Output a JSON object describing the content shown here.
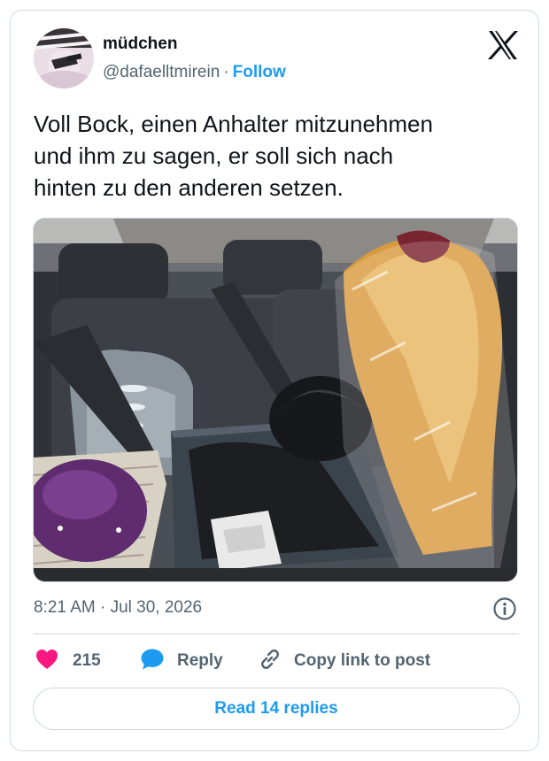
{
  "author": {
    "display_name": "müdchen",
    "handle": "@dafaelltmirein",
    "separator": "·",
    "follow_label": "Follow"
  },
  "tweet": {
    "text": "Voll Bock, einen Anhalter mitzunehmen\nund ihm zu sagen, er soll sich nach\nhinten zu den anderen setzen.",
    "timestamp": "8:21 AM · Jul 30, 2026"
  },
  "actions": {
    "like_count": "215",
    "reply_label": "Reply",
    "copy_label": "Copy link to post"
  },
  "read_replies_label": "Read 14 replies",
  "icons": {
    "brand": "x-logo-icon",
    "like": "heart-icon",
    "reply": "speech-bubble-icon",
    "copy": "link-icon",
    "info": "info-icon"
  },
  "colors": {
    "accent": "#1d9bf0",
    "like": "#f91880",
    "text": "#0f1419",
    "muted": "#536471",
    "border": "#cfd9de"
  }
}
